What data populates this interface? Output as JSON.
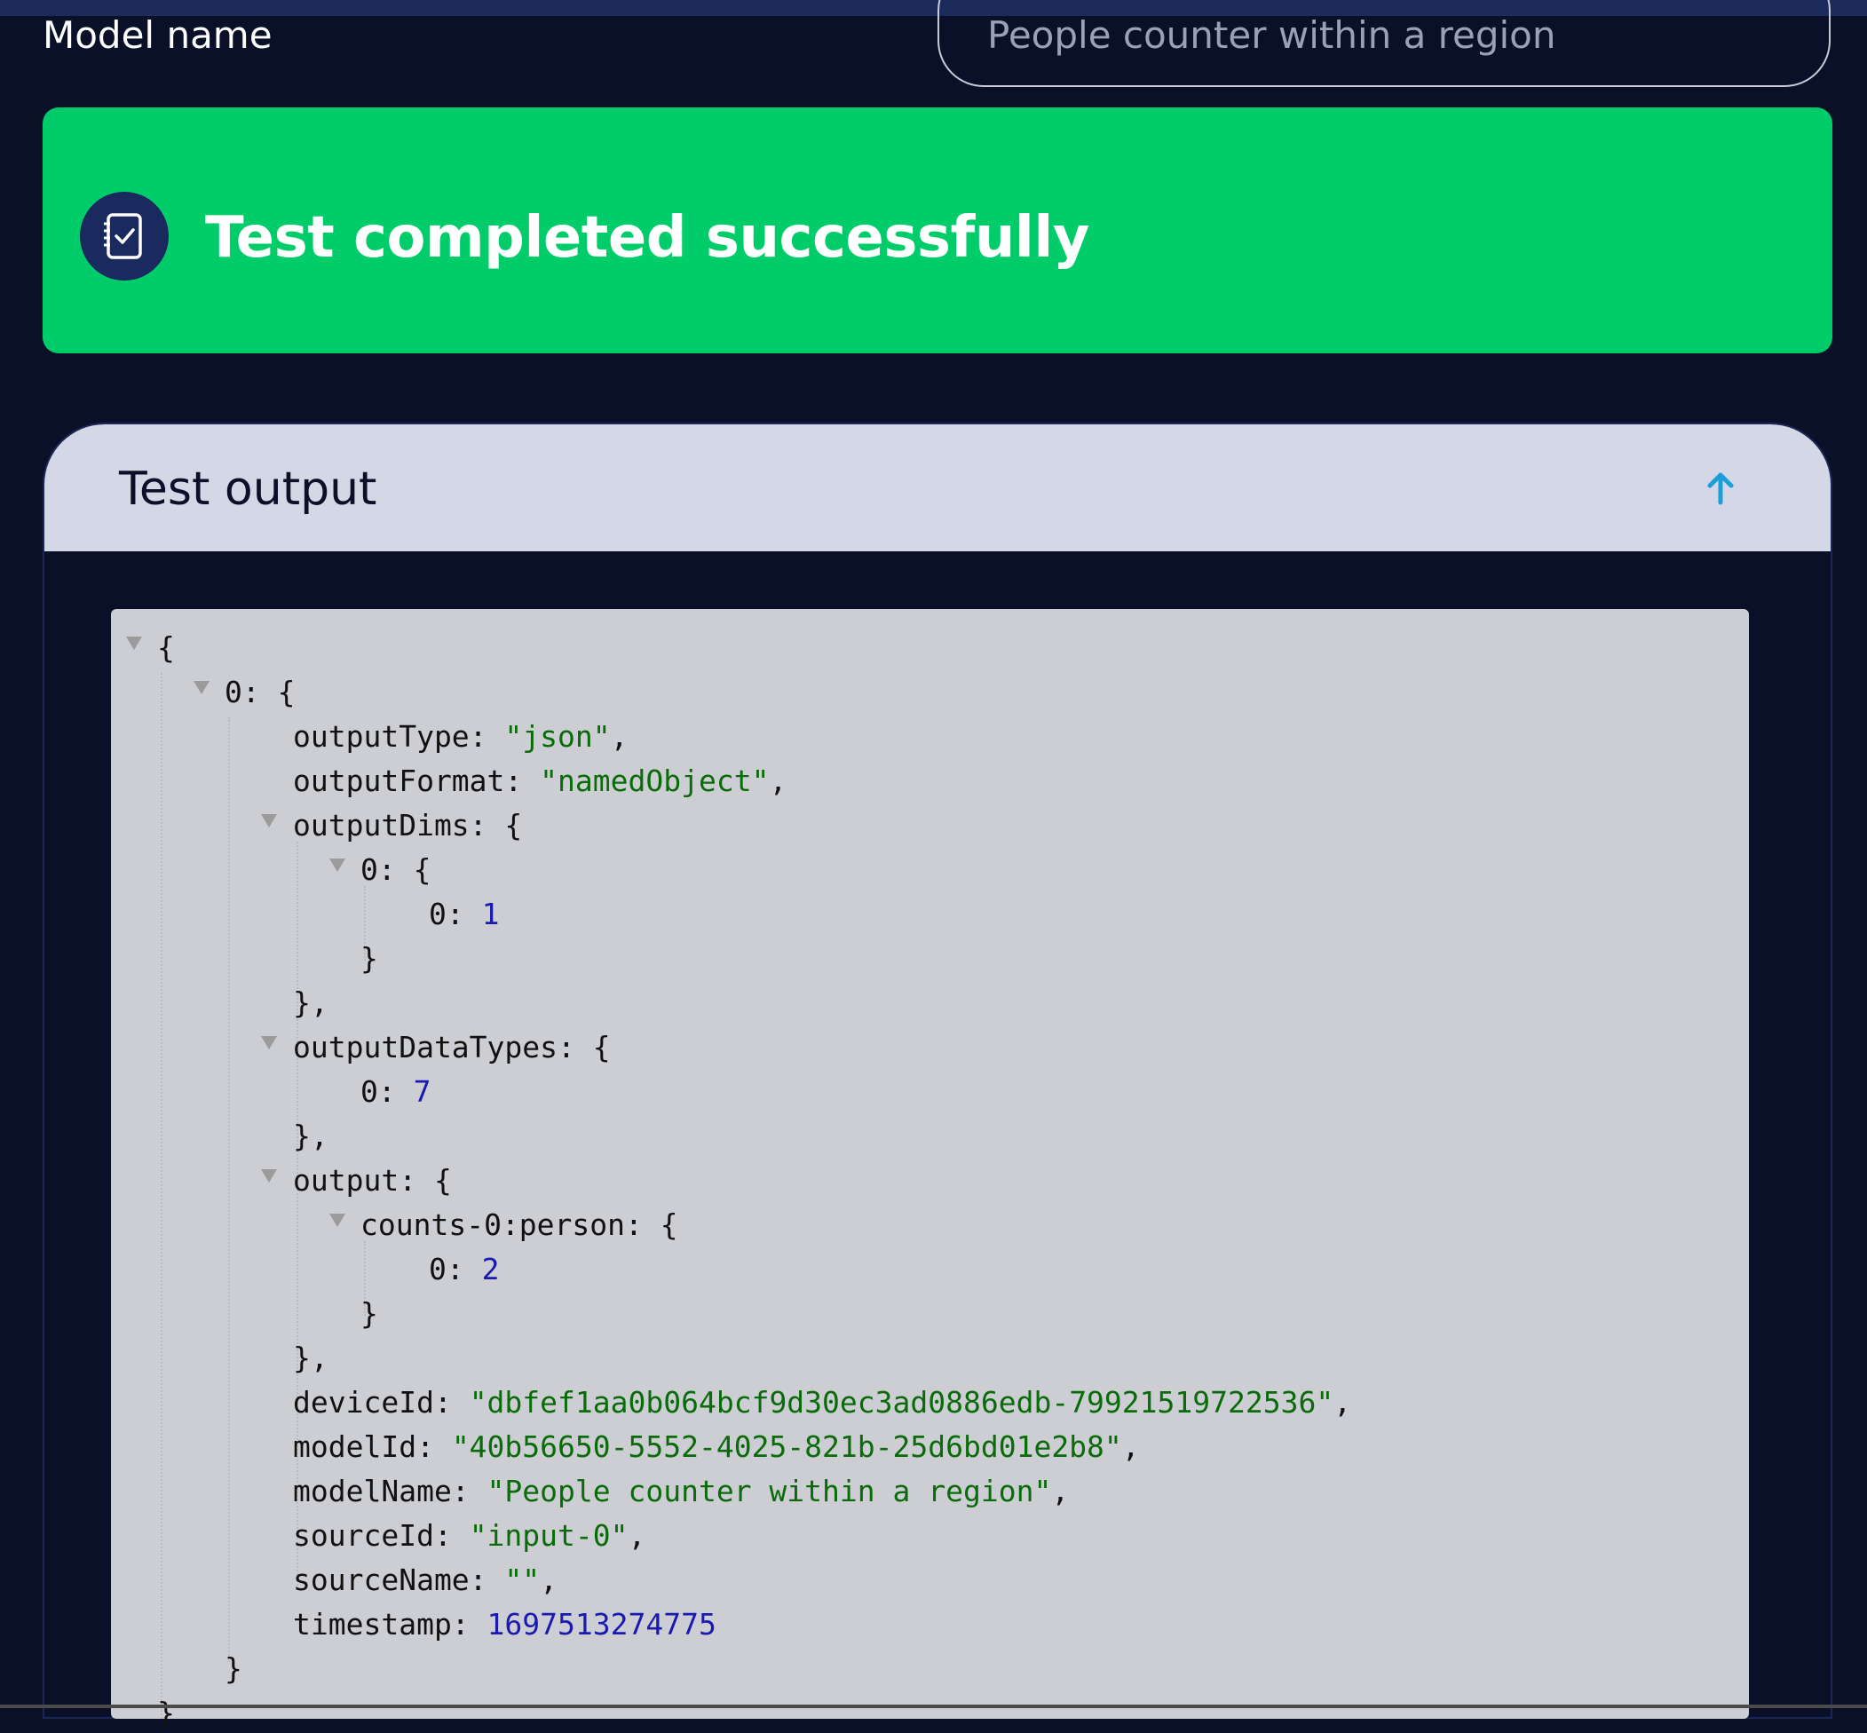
{
  "form": {
    "model_name_label": "Model name",
    "model_name_value": "People counter within a region"
  },
  "banner": {
    "title": "Test completed successfully",
    "icon": "notebook-check-icon",
    "color": "#00cc6a"
  },
  "panel": {
    "title": "Test output",
    "collapse_icon": "arrow-up-icon"
  },
  "json": {
    "open": "{",
    "item0_key": "0: ",
    "item0_open": "{",
    "outputType_key": "outputType: ",
    "outputType_val": "\"json\"",
    "outputFormat_key": "outputFormat: ",
    "outputFormat_val": "\"namedObject\"",
    "outputDims_key": "outputDims: ",
    "outputDims_inner_key": "0: ",
    "outputDims_inner_val_key": "0: ",
    "outputDims_inner_val": "1",
    "outputDataTypes_key": "outputDataTypes: ",
    "outputDataTypes_val_key": "0: ",
    "outputDataTypes_val": "7",
    "output_key": "output: ",
    "counts_key": "counts-0:person: ",
    "counts_val_key": "0: ",
    "counts_val": "2",
    "deviceId_key": "deviceId: ",
    "deviceId_val": "\"dbfef1aa0b064bcf9d30ec3ad0886edb-79921519722536\"",
    "modelId_key": "modelId: ",
    "modelId_val": "\"40b56650-5552-4025-821b-25d6bd01e2b8\"",
    "modelName_key": "modelName: ",
    "modelName_val": "\"People counter within a region\"",
    "sourceId_key": "sourceId: ",
    "sourceId_val": "\"input-0\"",
    "sourceName_key": "sourceName: ",
    "sourceName_val": "\"\"",
    "timestamp_key": "timestamp: ",
    "timestamp_val": "1697513274775"
  }
}
